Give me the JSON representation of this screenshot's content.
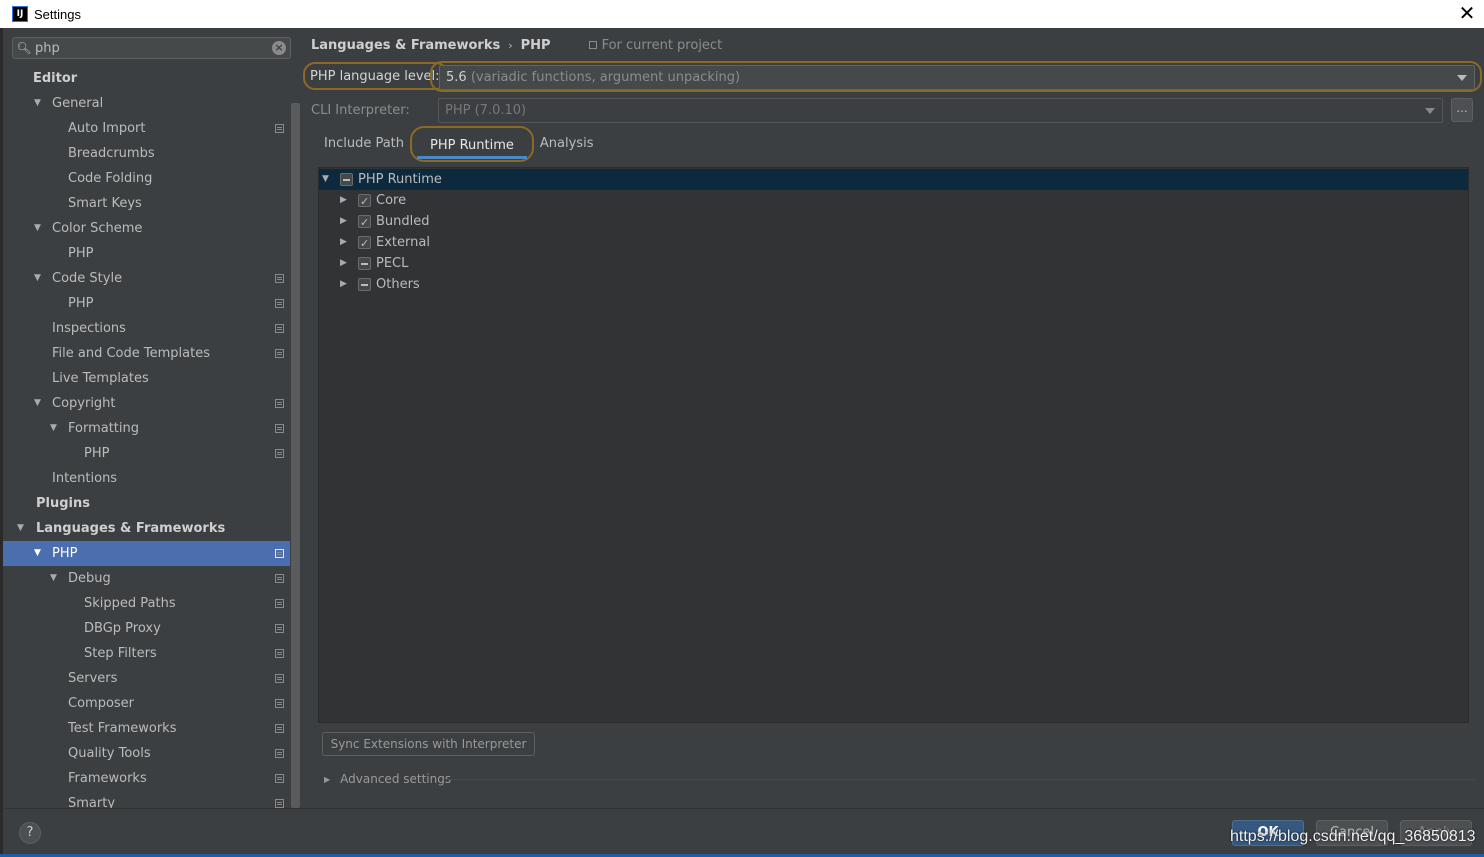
{
  "window": {
    "title": "Settings",
    "app_icon": "IJ"
  },
  "search": {
    "value": "php"
  },
  "sidebar": {
    "items": [
      {
        "label": "Editor",
        "level": 0,
        "bold": true,
        "arrow": "",
        "copy": false
      },
      {
        "label": "General",
        "level": 1,
        "arrow": "▼",
        "copy": false
      },
      {
        "label": "Auto Import",
        "level": 2,
        "arrow": "",
        "copy": true
      },
      {
        "label": "Breadcrumbs",
        "level": 2,
        "arrow": "",
        "copy": false
      },
      {
        "label": "Code Folding",
        "level": 2,
        "arrow": "",
        "copy": false
      },
      {
        "label": "Smart Keys",
        "level": 2,
        "arrow": "",
        "copy": false
      },
      {
        "label": "Color Scheme",
        "level": 1,
        "arrow": "▼",
        "copy": false
      },
      {
        "label": "PHP",
        "level": 2,
        "arrow": "",
        "copy": false
      },
      {
        "label": "Code Style",
        "level": 1,
        "arrow": "▼",
        "copy": true
      },
      {
        "label": "PHP",
        "level": 2,
        "arrow": "",
        "copy": true
      },
      {
        "label": "Inspections",
        "level": 1,
        "arrow": "",
        "copy": true
      },
      {
        "label": "File and Code Templates",
        "level": 1,
        "arrow": "",
        "copy": true
      },
      {
        "label": "Live Templates",
        "level": 1,
        "arrow": "",
        "copy": false
      },
      {
        "label": "Copyright",
        "level": 1,
        "arrow": "▼",
        "copy": true
      },
      {
        "label": "Formatting",
        "level": 2,
        "arrow": "▼",
        "copy": true
      },
      {
        "label": "PHP",
        "level": 3,
        "arrow": "",
        "copy": true
      },
      {
        "label": "Intentions",
        "level": 1,
        "arrow": "",
        "copy": false
      },
      {
        "label": "Plugins",
        "level": 0,
        "bold": true,
        "arrow": "",
        "copy": false
      },
      {
        "label": "Languages & Frameworks",
        "level": 0,
        "bold": true,
        "arrow": "▼",
        "copy": false
      },
      {
        "label": "PHP",
        "level": 1,
        "arrow": "▼",
        "copy": true,
        "selected": true
      },
      {
        "label": "Debug",
        "level": 2,
        "arrow": "▼",
        "copy": true
      },
      {
        "label": "Skipped Paths",
        "level": 3,
        "arrow": "",
        "copy": true
      },
      {
        "label": "DBGp Proxy",
        "level": 3,
        "arrow": "",
        "copy": true
      },
      {
        "label": "Step Filters",
        "level": 3,
        "arrow": "",
        "copy": true
      },
      {
        "label": "Servers",
        "level": 2,
        "arrow": "",
        "copy": true
      },
      {
        "label": "Composer",
        "level": 2,
        "arrow": "",
        "copy": true
      },
      {
        "label": "Test Frameworks",
        "level": 2,
        "arrow": "",
        "copy": true
      },
      {
        "label": "Quality Tools",
        "level": 2,
        "arrow": "",
        "copy": true
      },
      {
        "label": "Frameworks",
        "level": 2,
        "arrow": "",
        "copy": true
      },
      {
        "label": "Smarty",
        "level": 2,
        "arrow": "",
        "copy": true
      }
    ]
  },
  "breadcrumb": {
    "parent": "Languages & Frameworks",
    "current": "PHP",
    "scope": "For current project"
  },
  "language_level": {
    "label": "PHP language level:",
    "version": "5.6",
    "detail": "(variadic functions, argument unpacking)"
  },
  "cli": {
    "label": "CLI Interpreter:",
    "name": "PHP",
    "version": "(7.0.10)",
    "browse": "..."
  },
  "tabs": [
    "Include Path",
    "PHP Runtime",
    "Analysis"
  ],
  "runtime_tree": [
    {
      "label": "PHP Runtime",
      "level": 0,
      "arrow": "▼",
      "check": "partial",
      "selected": true
    },
    {
      "label": "Core",
      "level": 1,
      "arrow": "▶",
      "check": "checked"
    },
    {
      "label": "Bundled",
      "level": 1,
      "arrow": "▶",
      "check": "checked"
    },
    {
      "label": "External",
      "level": 1,
      "arrow": "▶",
      "check": "checked"
    },
    {
      "label": "PECL",
      "level": 1,
      "arrow": "▶",
      "check": "partial"
    },
    {
      "label": "Others",
      "level": 1,
      "arrow": "▶",
      "check": "partial"
    }
  ],
  "sync_button": "Sync Extensions with Interpreter",
  "advanced": "Advanced settings",
  "footer": {
    "help": "?",
    "ok": "OK",
    "cancel": "Cancel",
    "apply": "Apply",
    "watermark": "https://blog.csdn.net/qq_36850813"
  }
}
